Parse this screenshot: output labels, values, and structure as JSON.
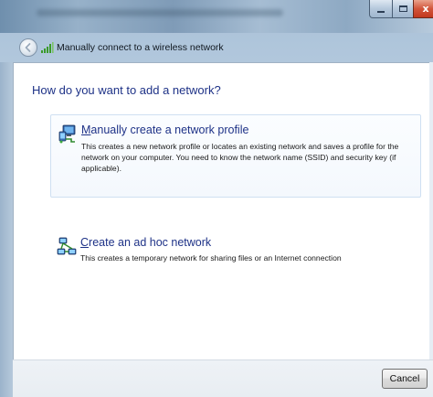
{
  "window": {
    "title": "Manually connect to a wireless network",
    "controls": {
      "minimize_icon": "minimize-icon",
      "maximize_icon": "maximize-icon",
      "close_glyph": "x"
    }
  },
  "main": {
    "question": "How do you want to add a network?",
    "options": [
      {
        "title_prefix": "",
        "title_underline": "M",
        "title_rest": "anually create a network profile",
        "description": "This creates a new network profile or locates an existing network and saves a profile for the network on your computer. You need to know the network name (SSID) and security key (if applicable).",
        "icon": "network-profile-icon"
      },
      {
        "title_prefix": "",
        "title_underline": "C",
        "title_rest": "reate an ad hoc network",
        "description": "This creates a temporary network for sharing files or an Internet connection",
        "icon": "ad-hoc-network-icon"
      }
    ]
  },
  "footer": {
    "cancel_label": "Cancel"
  },
  "colors": {
    "link_blue": "#1e3287",
    "close_red": "#c2381e"
  }
}
